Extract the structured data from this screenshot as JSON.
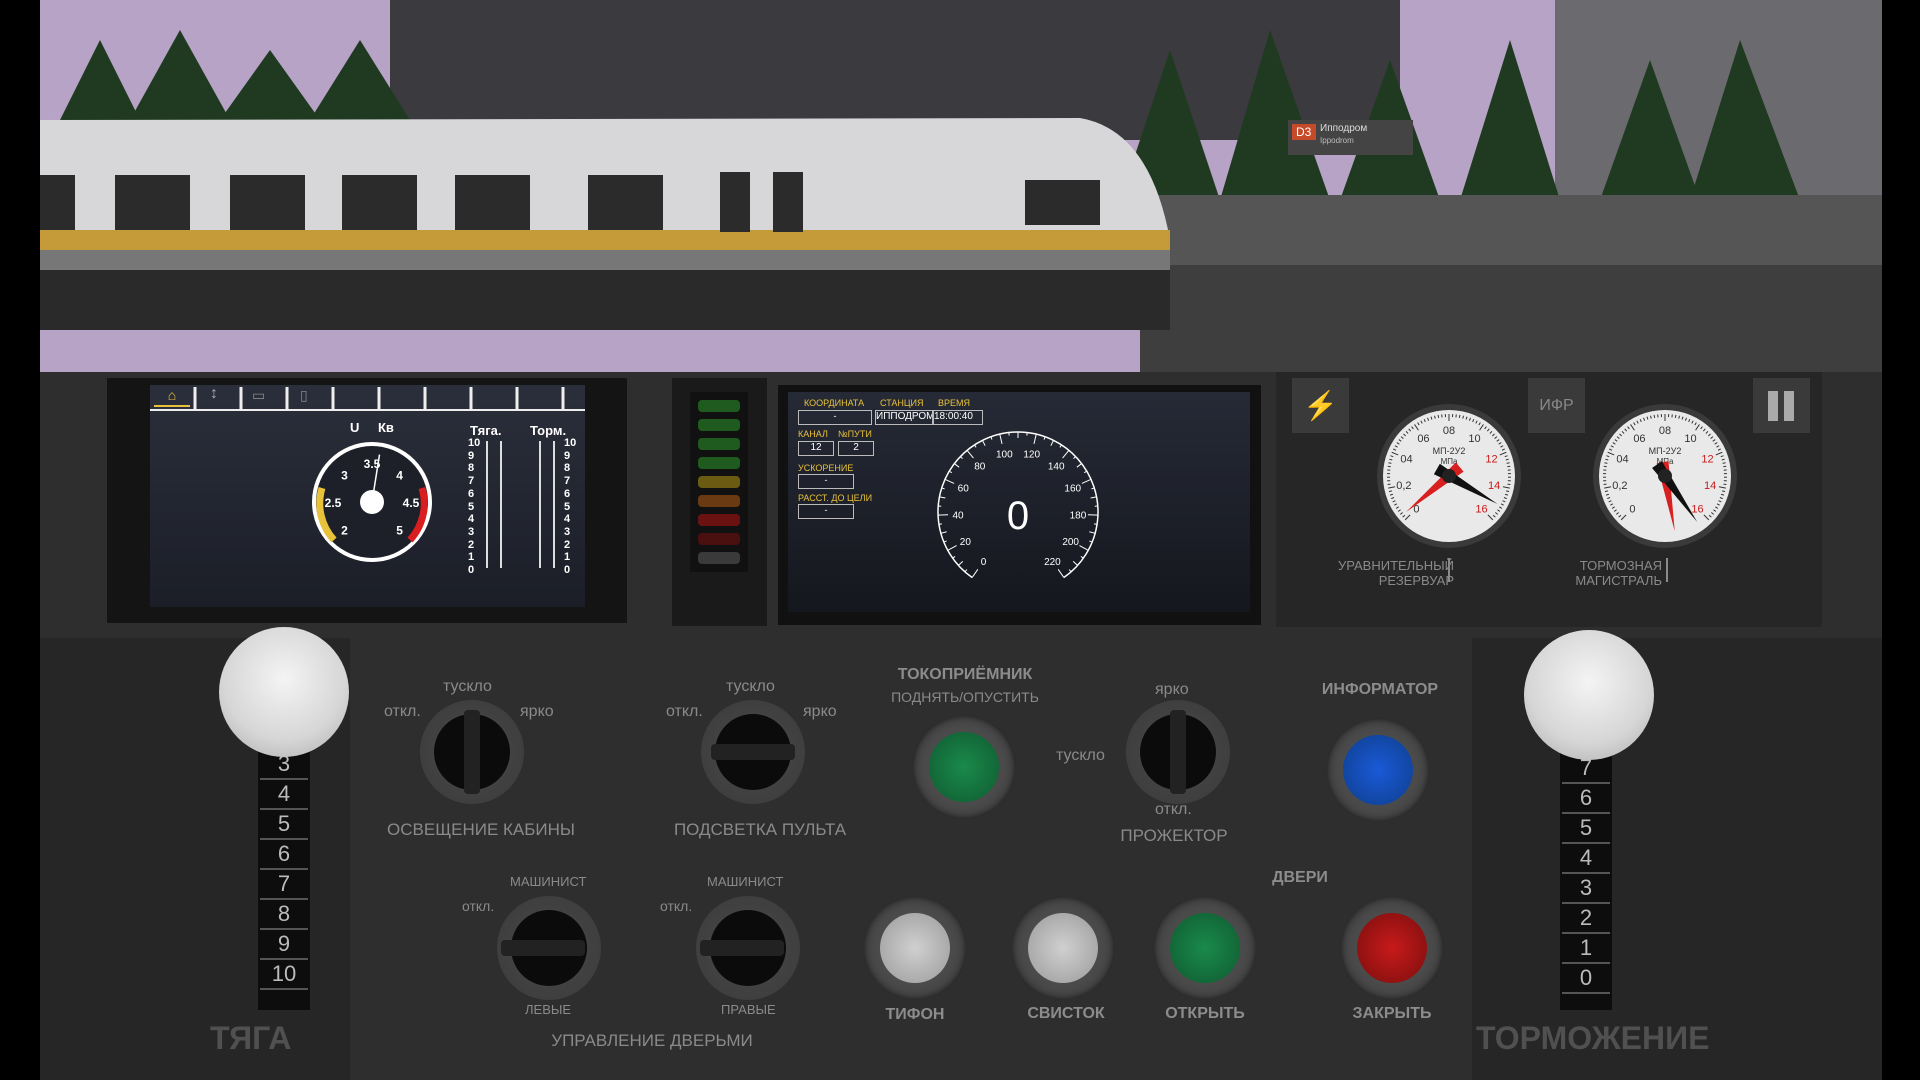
{
  "scene": {
    "station_sign_line": "D3",
    "station_sign_name": "Ипподром",
    "station_sign_sub": "Ippodrom"
  },
  "left_display": {
    "voltage_label": "U",
    "unit_label": "Кв",
    "gauge_ticks": [
      "2",
      "2.5",
      "3",
      "3.5",
      "4",
      "4.5",
      "5"
    ],
    "traction_label": "Тяга.",
    "brake_label": "Торм.",
    "scale_numbers": [
      "10",
      "9",
      "8",
      "7",
      "6",
      "5",
      "4",
      "3",
      "2",
      "1",
      "0"
    ],
    "voltage_value": 3.6
  },
  "indicator_lamps": [
    "#1f5a1f",
    "#1f5a1f",
    "#1f5a1f",
    "#1f5a1f",
    "#6a5a12",
    "#6a3a12",
    "#6a1212",
    "#4a1010",
    "#3a3a3a"
  ],
  "mid_display": {
    "coord_label": "КООРДИНАТА",
    "coord_value": "-",
    "station_label": "СТАНЦИЯ",
    "station_value": "ИППОДРОМ",
    "time_label": "ВРЕМЯ",
    "time_value": "18:00:40",
    "channel_label": "КАНАЛ",
    "channel_value": "12",
    "track_label": "№ПУТИ",
    "track_value": "2",
    "accel_label": "УСКОРЕНИЕ",
    "accel_value": "-",
    "dist_label": "РАССТ. ДО ЦЕЛИ",
    "dist_value": "-",
    "speed_value": "0",
    "speed_ticks": [
      "0",
      "20",
      "40",
      "60",
      "80",
      "100",
      "120",
      "140",
      "160",
      "180",
      "200",
      "220"
    ]
  },
  "gauges": {
    "ifr_button": "ИФР",
    "g1_label_l1": "УРАВНИТЕЛЬНЫЙ",
    "g1_label_l2": "РЕЗЕРВУАР",
    "g2_label_l1": "ТОРМОЗНАЯ",
    "g2_label_l2": "МАГИСТРАЛЬ",
    "model": "МП-2У2",
    "unit": "МПа",
    "dial_ticks": [
      "0",
      "0,2",
      "04",
      "06",
      "08",
      "10",
      "12",
      "14",
      "16"
    ]
  },
  "controls": {
    "traction_title": "ТЯГА",
    "traction_scale": [
      "3",
      "4",
      "5",
      "6",
      "7",
      "8",
      "9",
      "10"
    ],
    "braking_title": "ТОРМОЖЕНИЕ",
    "braking_scale": [
      "7",
      "6",
      "5",
      "4",
      "3",
      "2",
      "1",
      "0"
    ],
    "cabin_light_label": "ОСВЕЩЕНИЕ КАБИНЫ",
    "console_light_label": "ПОДСВЕТКА ПУЛЬТА",
    "off": "откл.",
    "dim": "тускло",
    "bright": "ярко",
    "pantograph_title": "ТОКОПРИЁМНИК",
    "pantograph_sub": "ПОДНЯТЬ/ОПУСТИТЬ",
    "headlight_label": "ПРОЖЕКТОР",
    "informer_label": "ИНФОРМАТОР",
    "doors_title": "ДВЕРИ",
    "door_control_label": "УПРАВЛЕНИЕ ДВЕРЬМИ",
    "driver": "МАШИНИСТ",
    "left": "ЛЕВЫЕ",
    "right": "ПРАВЫЕ",
    "horn_label": "ТИФОН",
    "whistle_label": "СВИСТОК",
    "open_label": "ОТКРЫТЬ",
    "close_label": "ЗАКРЫТЬ"
  },
  "colors": {
    "green_button": "#0f6b3a",
    "blue_button": "#0d3d8a",
    "red_button": "#8a0f0f",
    "white_button": "#bdbdbd",
    "display_yellow": "#e8c23a"
  }
}
